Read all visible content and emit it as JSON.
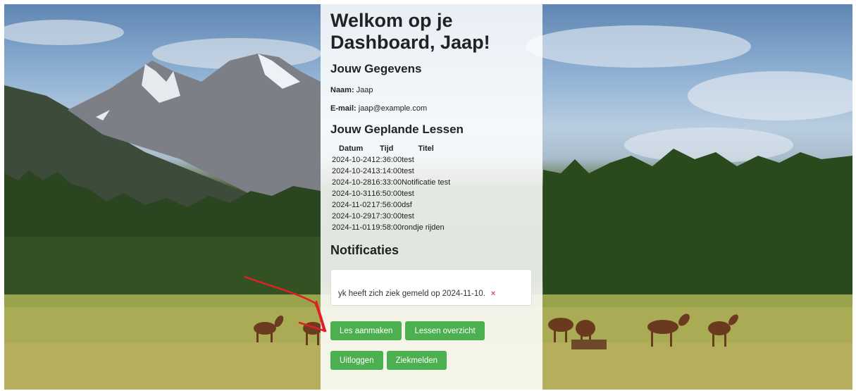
{
  "page": {
    "title": "Welkom op je Dashboard, Jaap!"
  },
  "profile": {
    "heading": "Jouw Gegevens",
    "name_label": "Naam:",
    "name_value": "Jaap",
    "email_label": "E-mail:",
    "email_value": "jaap@example.com"
  },
  "lessons": {
    "heading": "Jouw Geplande Lessen",
    "columns": [
      "Datum",
      "Tijd",
      "Titel"
    ],
    "rows": [
      {
        "date": "2024-10-24",
        "time": "12:36:00",
        "title": "test"
      },
      {
        "date": "2024-10-24",
        "time": "13:14:00",
        "title": "test"
      },
      {
        "date": "2024-10-28",
        "time": "16:33:00",
        "title": "Notificatie test"
      },
      {
        "date": "2024-10-31",
        "time": "16:50:00",
        "title": "test"
      },
      {
        "date": "2024-11-02",
        "time": "17:56:00",
        "title": "dsf"
      },
      {
        "date": "2024-10-29",
        "time": "17:30:00",
        "title": "test"
      },
      {
        "date": "2024-11-01",
        "time": "19:58:00",
        "title": "rondje rijden"
      }
    ]
  },
  "notifications": {
    "heading": "Notificaties",
    "items": [
      {
        "text": "yk heeft zich ziek gemeld op 2024-11-10.",
        "dismiss": "×"
      }
    ]
  },
  "actions": {
    "create_lesson": "Les aanmaken",
    "lesson_overview": "Lessen overzicht",
    "logout": "Uitloggen",
    "report_sick": "Ziekmelden"
  },
  "colors": {
    "button": "#4caf50",
    "dismiss": "#d9534f",
    "annotation_arrow": "#e02020"
  }
}
